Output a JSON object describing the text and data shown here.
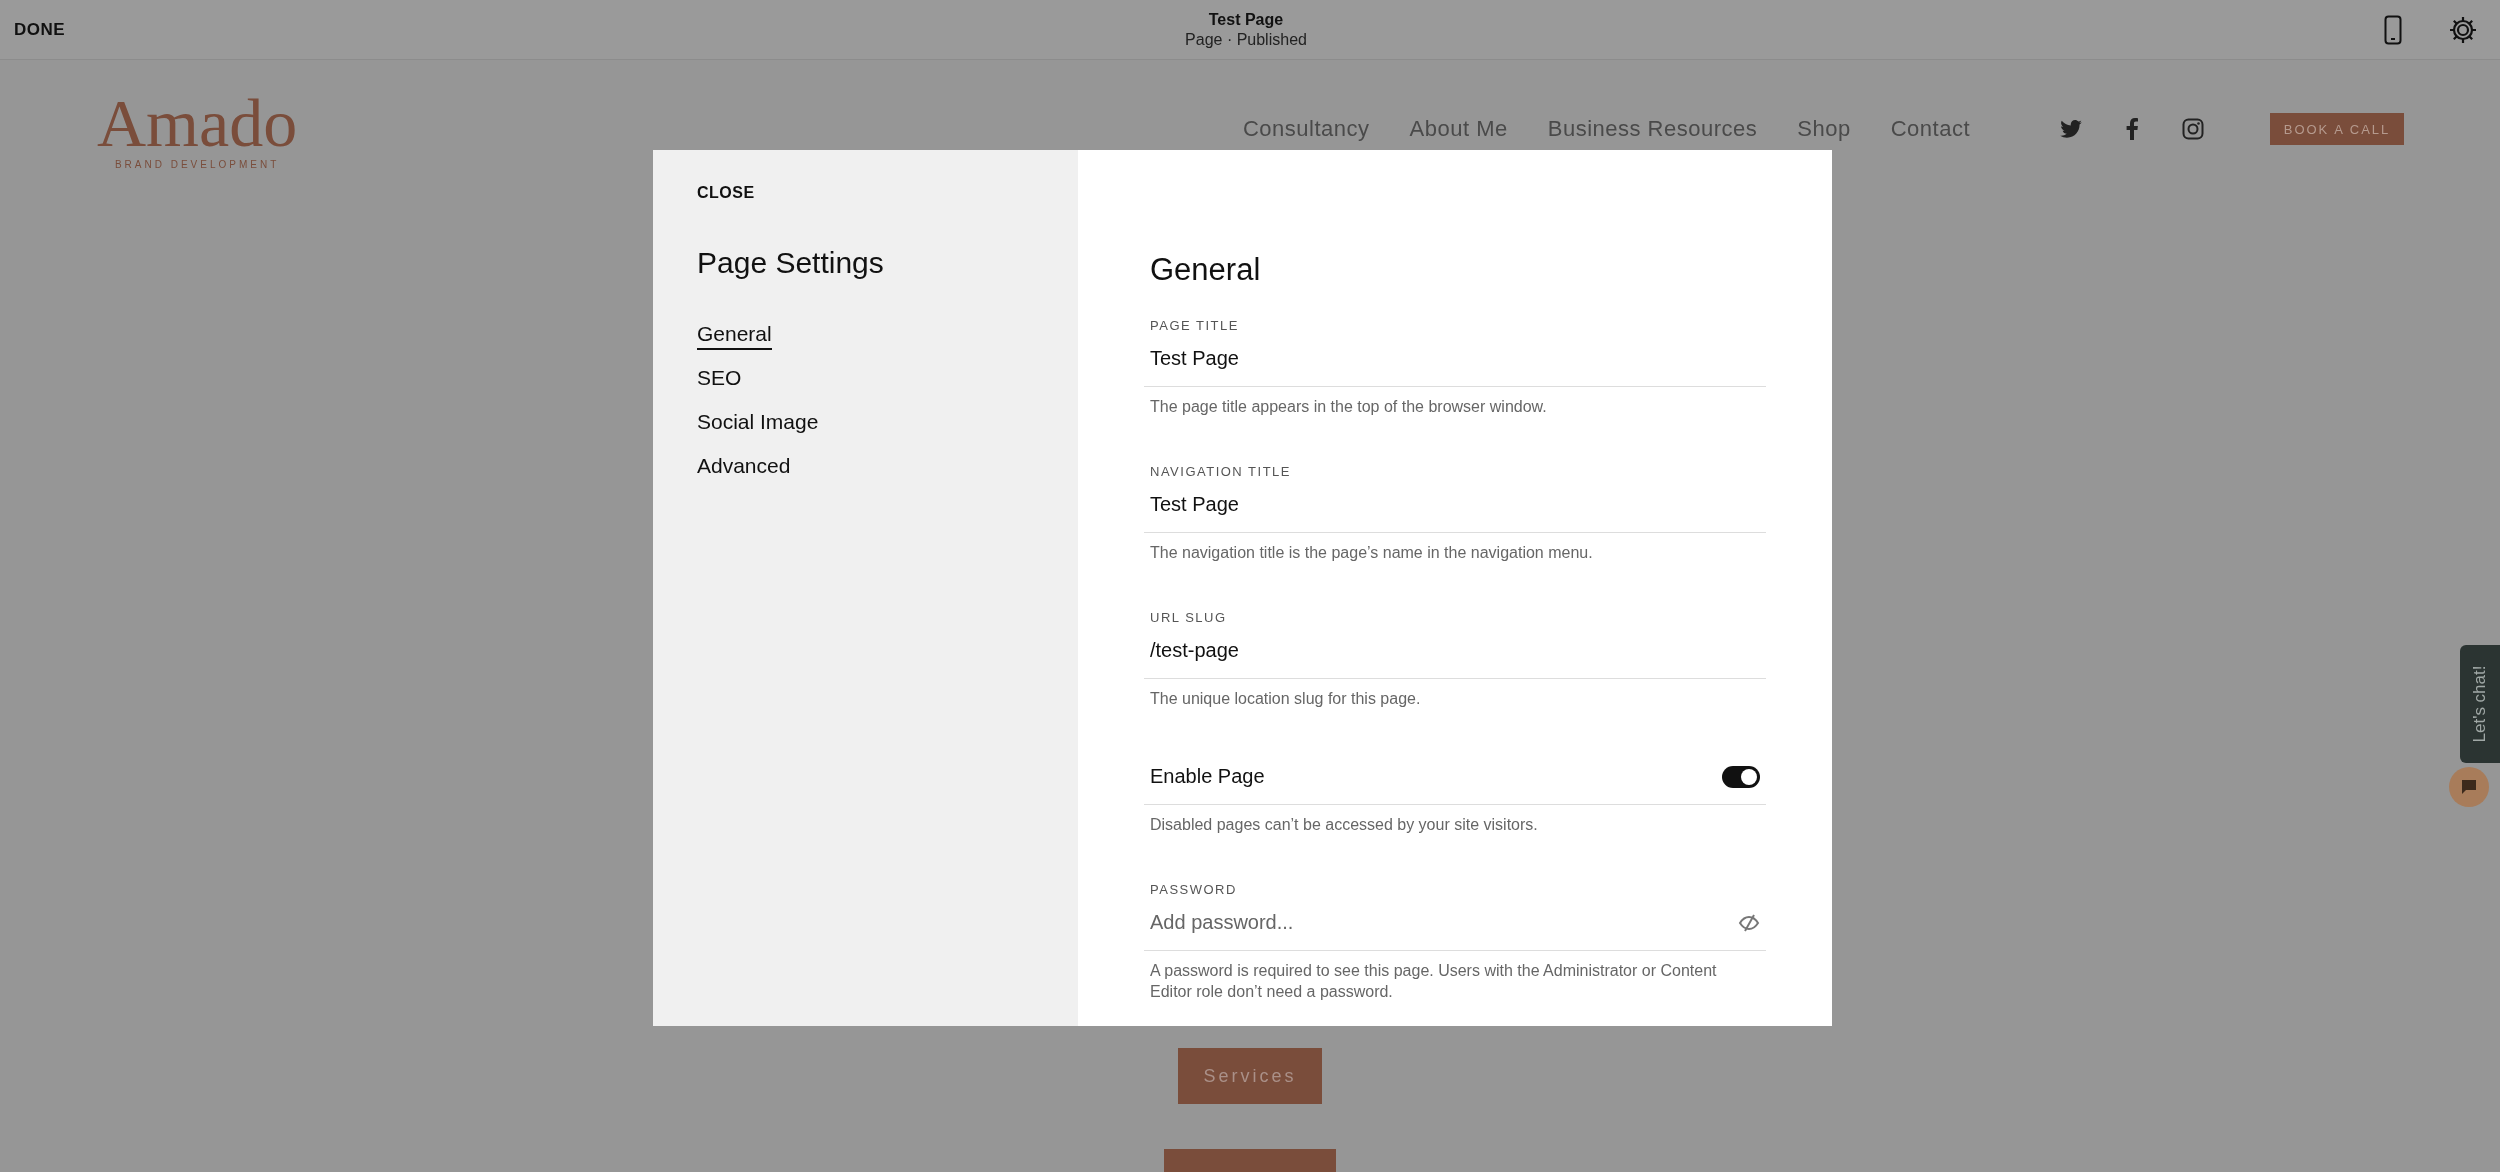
{
  "top_bar": {
    "done": "DONE",
    "title": "Test Page",
    "subtitle": "Page · Published"
  },
  "site_header": {
    "logo": "Amado",
    "tagline": "BRAND DEVELOPMENT",
    "nav": [
      "Consultancy",
      "About Me",
      "Business Resources",
      "Shop",
      "Contact"
    ],
    "book_button": "BOOK A CALL"
  },
  "page_buttons": [
    "Services"
  ],
  "chat": {
    "label": "Let's chat!"
  },
  "modal": {
    "close": "CLOSE",
    "title": "Page Settings",
    "nav": [
      {
        "label": "General",
        "selected": true
      },
      {
        "label": "SEO",
        "selected": false
      },
      {
        "label": "Social Image",
        "selected": false
      },
      {
        "label": "Advanced",
        "selected": false
      }
    ],
    "section_title": "General",
    "fields": [
      {
        "kind": "text",
        "label": "PAGE TITLE",
        "value": "Test Page",
        "helper": "The page title appears in the top of the browser window."
      },
      {
        "kind": "text",
        "label": "NAVIGATION TITLE",
        "value": "Test Page",
        "helper": "The navigation title is the page’s name in the navigation menu."
      },
      {
        "kind": "text",
        "label": "URL SLUG",
        "value": "/test-page",
        "helper": "The unique location slug for this page."
      },
      {
        "kind": "toggle",
        "label": "Enable Page",
        "on": true,
        "helper": "Disabled pages can’t be accessed by your site visitors."
      },
      {
        "kind": "password",
        "label": "PASSWORD",
        "placeholder": "Add password...",
        "helper": "A password is required to see this page. Users with the Administrator or Content Editor role don’t need a password."
      }
    ]
  }
}
